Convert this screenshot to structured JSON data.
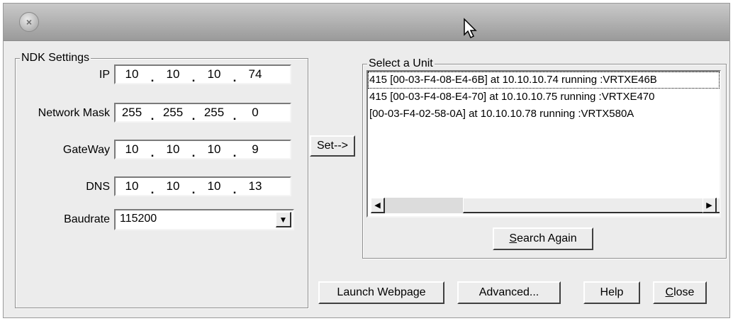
{
  "window": {
    "close_symbol": "×"
  },
  "ndk": {
    "legend": "NDK Settings",
    "ip": {
      "label": "IP",
      "octets": [
        "10",
        "10",
        "10",
        "74"
      ]
    },
    "mask": {
      "label": "Network Mask",
      "octets": [
        "255",
        "255",
        "255",
        "0"
      ]
    },
    "gateway": {
      "label": "GateWay",
      "octets": [
        "10",
        "10",
        "10",
        "9"
      ]
    },
    "dns": {
      "label": "DNS",
      "octets": [
        "10",
        "10",
        "10",
        "13"
      ]
    },
    "baudrate": {
      "label": "Baudrate",
      "value": "115200"
    }
  },
  "set_button": "Set-->",
  "units": {
    "legend": "Select a Unit",
    "items": [
      "415 [00-03-F4-08-E4-6B] at 10.10.10.74 running :VRTXE46B",
      "415 [00-03-F4-08-E4-70] at 10.10.10.75 running :VRTXE470",
      "[00-03-F4-02-58-0A] at 10.10.10.78 running :VRTX580A"
    ],
    "search_again": {
      "mnemonic": "S",
      "rest": "earch Again"
    }
  },
  "buttons": {
    "launch": "Launch Webpage",
    "advanced": "Advanced...",
    "help": "Help",
    "close": {
      "mnemonic": "C",
      "rest": "lose"
    }
  },
  "icons": {
    "close": "window-close-icon",
    "cursor": "mouse-cursor-icon",
    "dropdown": "chevron-down-icon",
    "scroll_left": "arrow-left-icon",
    "scroll_right": "arrow-right-icon"
  }
}
